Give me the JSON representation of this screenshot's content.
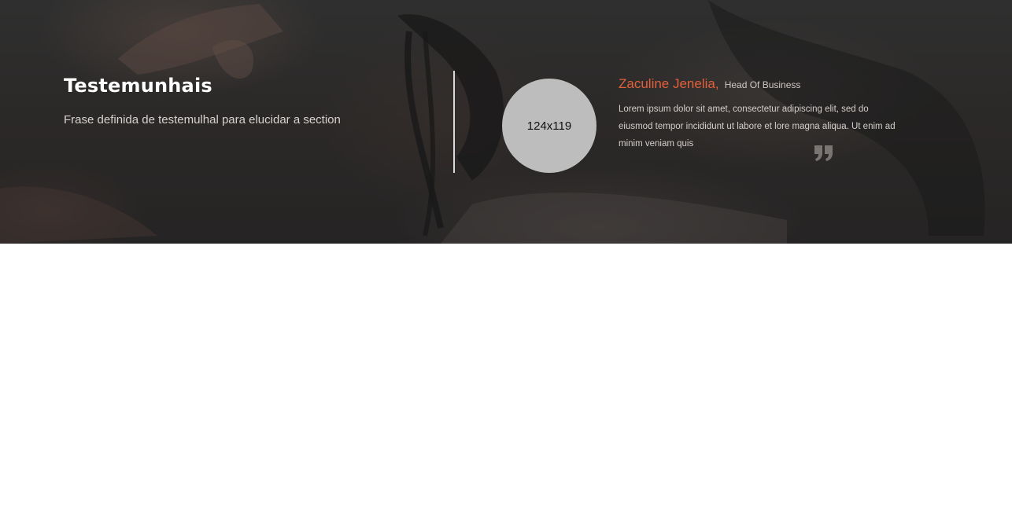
{
  "testimonials": {
    "title": "Testemunhais",
    "subtitle": "Frase definida de testemulhal para elucidar a section",
    "avatar_placeholder": "124x119",
    "author_name": "Zaculine Jenelia",
    "author_separator": ",",
    "author_role": "Head Of Business",
    "quote_text": "Lorem ipsum dolor sit amet, consectetur adipiscing elit, sed do eiusmod tempor incididunt ut labore et lore magna aliqua. Ut enim ad minim veniam quis",
    "quote_icon": "quote-icon"
  },
  "colors": {
    "accent": "#e2603a",
    "overlay": "#2e2e2e",
    "avatar_bg": "#bdbdbd"
  }
}
